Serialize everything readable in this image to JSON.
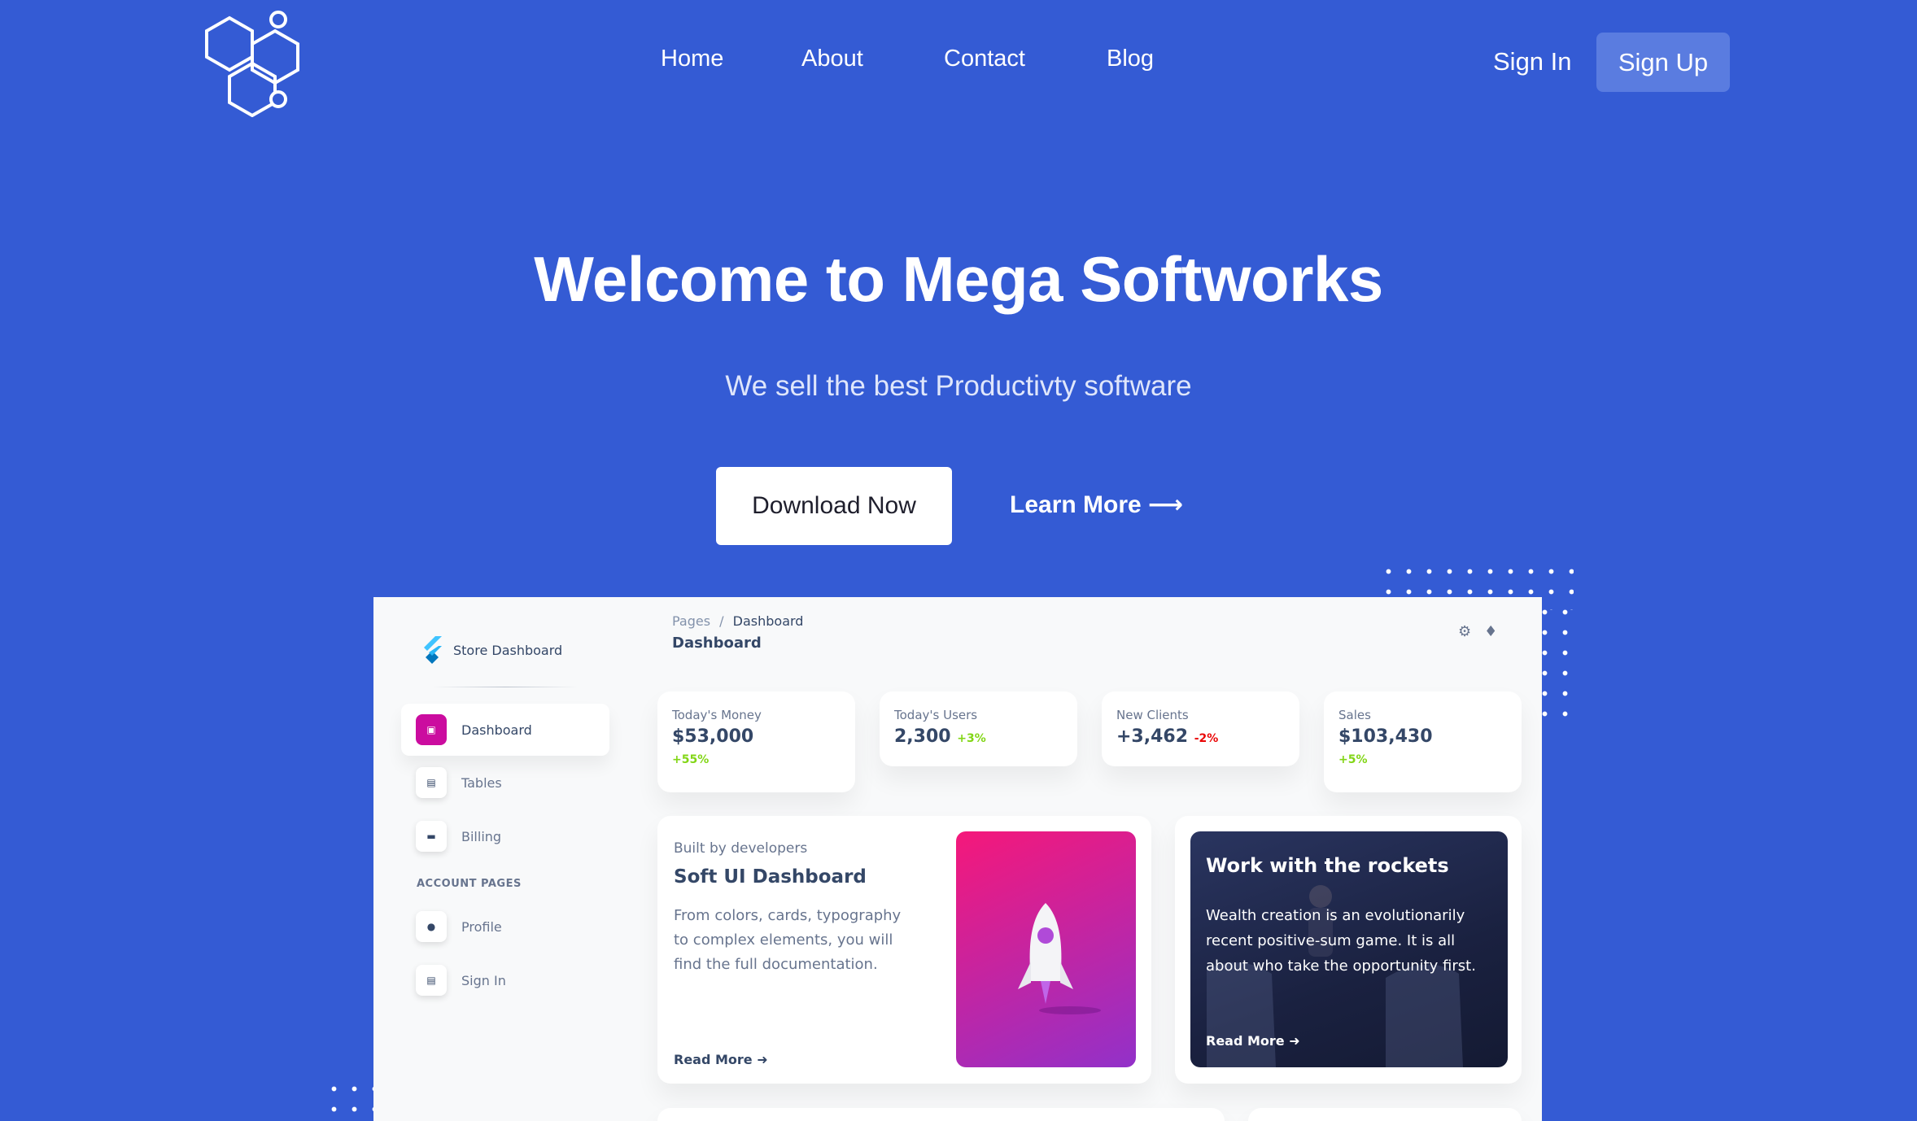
{
  "nav": {
    "links": [
      "Home",
      "About",
      "Contact",
      "Blog"
    ],
    "sign_in": "Sign In",
    "sign_up": "Sign Up"
  },
  "hero": {
    "title": "Welcome to Mega Softworks",
    "subtitle": "We sell the best Productivty software",
    "download_label": "Download Now",
    "learn_more_label": "Learn More ⟶"
  },
  "dashboard": {
    "brand": "Store Dashboard",
    "sidebar": {
      "items": [
        "Dashboard",
        "Tables",
        "Billing"
      ],
      "account_heading": "ACCOUNT PAGES",
      "account_items": [
        "Profile",
        "Sign In"
      ]
    },
    "breadcrumb": {
      "parent": "Pages",
      "separator": "/",
      "current": "Dashboard"
    },
    "page_title": "Dashboard",
    "stats": [
      {
        "label": "Today's Money",
        "value": "$53,000",
        "change": "+55%"
      },
      {
        "label": "Today's Users",
        "value": "2,300",
        "change": "+3%"
      },
      {
        "label": "New Clients",
        "value": "+3,462",
        "change": "-2%"
      },
      {
        "label": "Sales",
        "value": "$103,430",
        "change": "+5%"
      }
    ],
    "card_soft": {
      "kicker": "Built by developers",
      "title": "Soft UI Dashboard",
      "text": "From colors, cards, typography to complex elements, you will find the full documentation.",
      "read_more": "Read More"
    },
    "card_rockets": {
      "title": "Work with the rockets",
      "text": "Wealth creation is an evolutionarily recent positive-sum game. It is all about who take the opportunity first.",
      "read_more": "Read More"
    }
  },
  "colors": {
    "background": "#345bd4",
    "sign_up_bg": "#5a7ce0",
    "accent_pink": "#cb0c9f",
    "positive": "#82d616",
    "negative": "#ea0606"
  }
}
